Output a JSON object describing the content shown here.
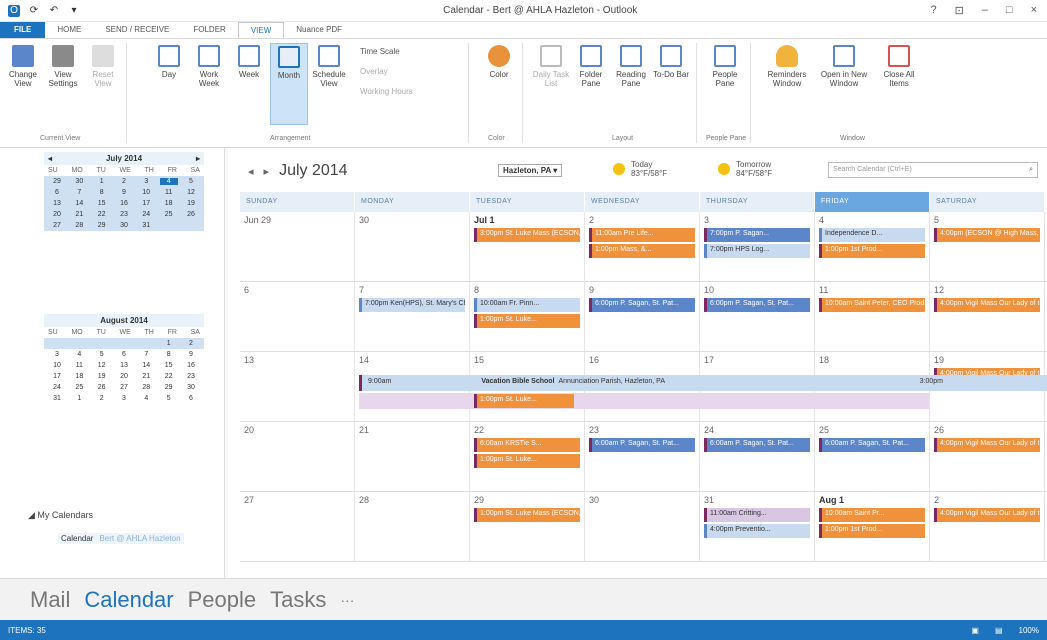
{
  "window": {
    "title": "Calendar - Bert @ AHLA Hazleton - Outlook",
    "controls": [
      "?",
      "⊡",
      "–",
      "□",
      "×"
    ]
  },
  "ribbon_tabs": [
    "FILE",
    "HOME",
    "SEND / RECEIVE",
    "FOLDER",
    "VIEW",
    "Nuance PDF"
  ],
  "ribbon": {
    "change_view": "Change View",
    "view_settings": "View Settings",
    "reset_view": "Reset View",
    "day": "Day",
    "work_week": "Work Week",
    "week": "Week",
    "month": "Month",
    "schedule_view": "Schedule View",
    "time_scale": "Time Scale",
    "overlay": "Overlay",
    "working_hours": "Working Hours",
    "color": "Color",
    "daily_task_list": "Daily Task List",
    "folder_pane": "Folder Pane",
    "reading_pane": "Reading Pane",
    "todo_bar": "To-Do Bar",
    "people_pane": "People Pane",
    "reminders": "Reminders Window",
    "open_new_window": "Open in New Window",
    "close_all": "Close All Items",
    "groups": [
      "Current View",
      "Arrangement",
      "Color",
      "Layout",
      "People Pane",
      "Window"
    ]
  },
  "minical": [
    {
      "header": "July 2014",
      "dow": [
        "SU",
        "MO",
        "TU",
        "WE",
        "TH",
        "FR",
        "SA"
      ],
      "weeks": [
        [
          "29",
          "30",
          "1",
          "2",
          "3",
          "4",
          "5"
        ],
        [
          "6",
          "7",
          "8",
          "9",
          "10",
          "11",
          "12"
        ],
        [
          "13",
          "14",
          "15",
          "16",
          "17",
          "18",
          "19"
        ],
        [
          "20",
          "21",
          "22",
          "23",
          "24",
          "25",
          "26"
        ],
        [
          "27",
          "28",
          "29",
          "30",
          "31",
          "",
          ""
        ]
      ]
    },
    {
      "header": "August 2014",
      "dow": [
        "SU",
        "MO",
        "TU",
        "WE",
        "TH",
        "FR",
        "SA"
      ],
      "weeks": [
        [
          "",
          "",
          "",
          "",
          "",
          "1",
          "2"
        ],
        [
          "3",
          "4",
          "5",
          "6",
          "7",
          "8",
          "9"
        ],
        [
          "10",
          "11",
          "12",
          "13",
          "14",
          "15",
          "16"
        ],
        [
          "17",
          "18",
          "19",
          "20",
          "21",
          "22",
          "23"
        ],
        [
          "24",
          "25",
          "26",
          "27",
          "28",
          "29",
          "30"
        ],
        [
          "31",
          "1",
          "2",
          "3",
          "4",
          "5",
          "6"
        ]
      ]
    }
  ],
  "my_calendars": "My Calendars",
  "calendar_item": {
    "label": "Calendar",
    "account": "Bert @ AHLA Hazleton"
  },
  "main": {
    "title": "July 2014",
    "location": "Hazleton, PA",
    "today_label": "Today",
    "today_temp": "83°F/58°F",
    "tomorrow_label": "Tomorrow",
    "tomorrow_temp": "84°F/58°F",
    "search_placeholder": "Search Calendar (Ctrl+E)",
    "days": [
      "SUNDAY",
      "MONDAY",
      "TUESDAY",
      "WEDNESDAY",
      "THURSDAY",
      "FRIDAY",
      "SATURDAY"
    ],
    "weeks": [
      {
        "nums": [
          "Jun 29",
          "30",
          "Jul 1",
          "2",
          "3",
          "4",
          "5"
        ],
        "events": [
          [],
          [],
          [
            {
              "c": "o",
              "t": "3:00pm St. Luke Mass (ECSON, M..."
            }
          ],
          [
            {
              "c": "o",
              "t": "11:00am Pre Life..."
            },
            {
              "c": "o",
              "t": "1:00pm Mass, &..."
            }
          ],
          [
            {
              "c": "b",
              "t": "7:00pm P. Sagan..."
            },
            {
              "c": "lb",
              "t": "7:00pm HPS Log..."
            }
          ],
          [
            {
              "c": "lb",
              "t": "Independence D..."
            },
            {
              "c": "o",
              "t": "1:00pm 1st Prod..."
            }
          ],
          [
            {
              "c": "o",
              "t": "4:00pm (ECSON @ High Mass, Our L..."
            }
          ]
        ]
      },
      {
        "nums": [
          "6",
          "7",
          "8",
          "9",
          "10",
          "11",
          "12"
        ],
        "events": [
          [],
          [
            {
              "c": "lb",
              "t": "7:00pm Ken(HPS), St. Mary's Churc..."
            }
          ],
          [
            {
              "c": "lb",
              "t": "10:00am Fr. Pinn..."
            },
            {
              "c": "o",
              "t": "1:00pm St. Luke..."
            }
          ],
          [
            {
              "c": "b",
              "t": "6:00pm P. Sagan, St. Pat..."
            }
          ],
          [
            {
              "c": "b",
              "t": "6:00pm P. Sagan, St. Pat..."
            }
          ],
          [
            {
              "c": "o",
              "t": "10:00am Saint Peter, CEO Prod..."
            }
          ],
          [
            {
              "c": "o",
              "t": "4:00pm Vigil Mass Our Lady of the L..."
            }
          ]
        ]
      },
      {
        "nums": [
          "13",
          "14",
          "15",
          "16",
          "17",
          "18",
          "19"
        ],
        "events": [
          [],
          [],
          [],
          [],
          [],
          [],
          [
            {
              "c": "o",
              "t": "4:00pm Vigil Mass Our Lady of the L..."
            }
          ]
        ],
        "bible": {
          "start": "9:00am",
          "title": "Vacation Bible School",
          "where": "Annunciation Parish, Hazleton, PA",
          "end": "3:00pm",
          "sub": "1:00pm St. Luke..."
        }
      },
      {
        "nums": [
          "20",
          "21",
          "22",
          "23",
          "24",
          "25",
          "26"
        ],
        "events": [
          [],
          [],
          [
            {
              "c": "o",
              "t": "6:00am KRSTie S..."
            },
            {
              "c": "o",
              "t": "1:00pm St. Luke..."
            }
          ],
          [
            {
              "c": "b",
              "t": "6:00am P. Sagan, St. Pat..."
            }
          ],
          [
            {
              "c": "b",
              "t": "6:00am P. Sagan, St. Pat..."
            }
          ],
          [
            {
              "c": "b",
              "t": "6:00am P. Sagan, St. Pat..."
            }
          ],
          [
            {
              "c": "o",
              "t": "4:00pm Vigil Mass Our Lady of the L..."
            }
          ]
        ]
      },
      {
        "nums": [
          "27",
          "28",
          "29",
          "30",
          "31",
          "Aug 1",
          "2"
        ],
        "events": [
          [],
          [],
          [
            {
              "c": "o",
              "t": "1:00pm St. Luke Mass (ECSON, M..."
            }
          ],
          [],
          [
            {
              "c": "p",
              "t": "11:00am Critting..."
            },
            {
              "c": "lb",
              "t": "4:00pm Preventio..."
            }
          ],
          [
            {
              "c": "o",
              "t": "10:00am Saint Pr..."
            },
            {
              "c": "o",
              "t": "1:00pm 1st Prod..."
            }
          ],
          [
            {
              "c": "o",
              "t": "4:00pm Vigil Mass Our Lady of the L..."
            }
          ]
        ]
      }
    ]
  },
  "bottom_nav": [
    "Mail",
    "Calendar",
    "People",
    "Tasks",
    "···"
  ],
  "status": {
    "items": "ITEMS: 35",
    "zoom": "100%"
  }
}
